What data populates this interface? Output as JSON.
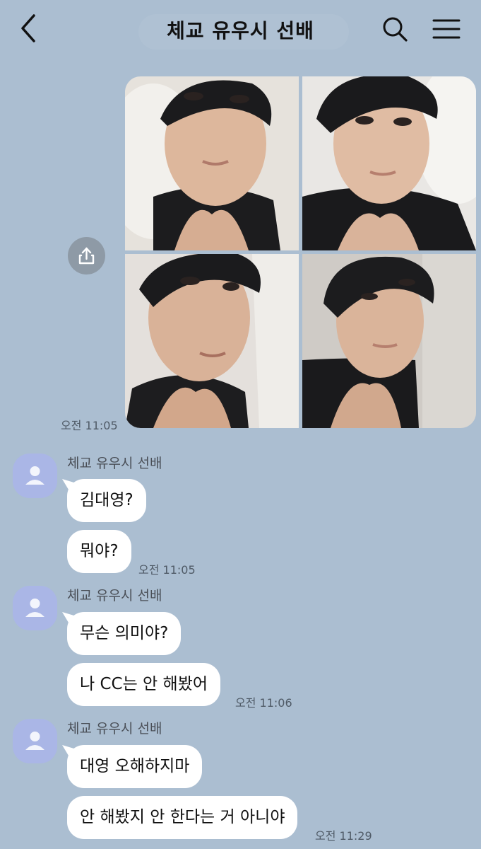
{
  "header": {
    "title": "체교 유우시 선배",
    "back_icon": "chevron-left-icon",
    "search_icon": "search-icon",
    "menu_icon": "hamburger-menu-icon"
  },
  "photo_message": {
    "photo_count": 4,
    "share_icon": "share-upload-icon",
    "time": "오전 11:05"
  },
  "groups": [
    {
      "sender": "체교 유우시 선배",
      "messages": [
        "김대영?",
        "뭐야?"
      ],
      "time": "오전 11:05"
    },
    {
      "sender": "체교 유우시 선배",
      "messages": [
        "무슨 의미야?",
        "나 CC는 안 해봤어"
      ],
      "time": "오전 11:06"
    },
    {
      "sender": "체교 유우시 선배",
      "messages": [
        "대영 오해하지마",
        "안 해봤지 안 한다는 거 아니야"
      ],
      "time": "오전 11:29"
    }
  ],
  "colors": {
    "chat_background": "#abbed1",
    "bubble": "#ffffff",
    "avatar": "#aab6e6"
  }
}
